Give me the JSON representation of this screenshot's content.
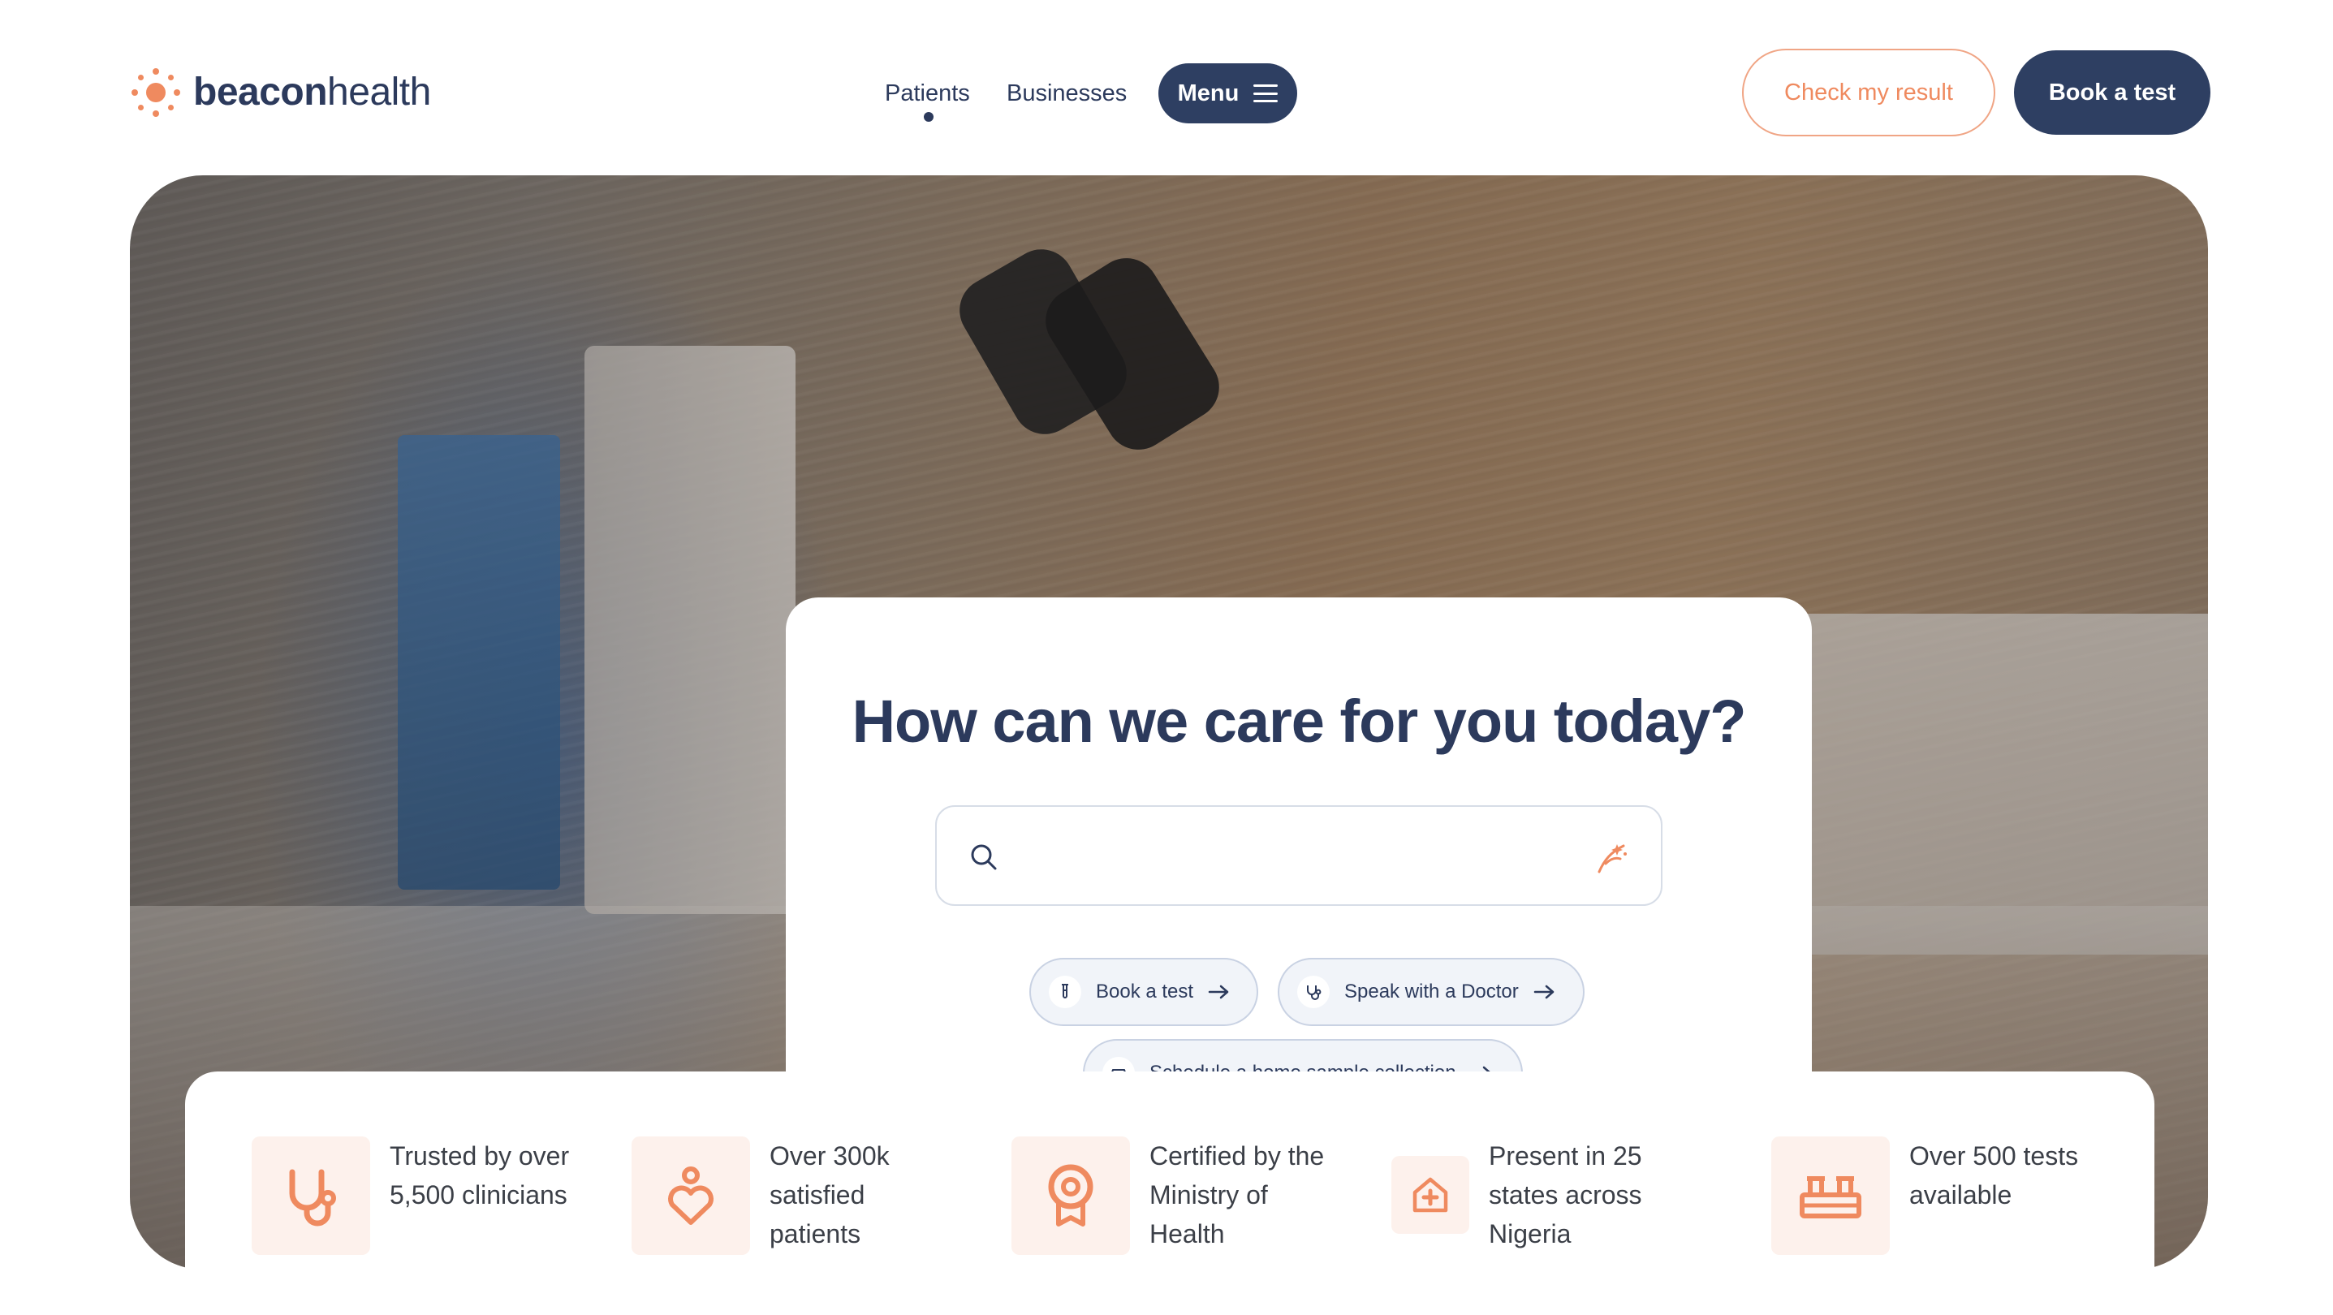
{
  "brand": {
    "name_bold": "beacon",
    "name_light": "health",
    "logo_icon": "sun-dots-icon",
    "accent_color": "#ef8a5f",
    "primary_color": "#2e3f62"
  },
  "nav": {
    "patients_label": "Patients",
    "businesses_label": "Businesses",
    "menu_label": "Menu",
    "active": "Patients"
  },
  "header_actions": {
    "check_result_label": "Check my result",
    "book_test_label": "Book a test"
  },
  "hero": {
    "title": "How can we care for you today?",
    "search": {
      "placeholder": "",
      "value": "",
      "search_icon": "search-icon",
      "assist_icon": "sparkle-icon"
    },
    "quick_actions": [
      {
        "label": "Book a test",
        "icon": "test-tube-icon"
      },
      {
        "label": "Speak with a Doctor",
        "icon": "stethoscope-icon"
      },
      {
        "label": "Schedule a home sample collection",
        "icon": "car-icon"
      }
    ]
  },
  "stats": [
    {
      "icon": "stethoscope-icon",
      "line1": "Trusted by over",
      "line2": "5,500 clinicians",
      "line3": ""
    },
    {
      "icon": "heart-person-icon",
      "line1": "Over 300k",
      "line2": "satisfied",
      "line3": "patients"
    },
    {
      "icon": "award-badge-icon",
      "line1": "Certified by the",
      "line2": "Ministry of",
      "line3": "Health"
    },
    {
      "icon": "hospital-icon",
      "line1": "Present in 25",
      "line2": "states across",
      "line3": "Nigeria"
    },
    {
      "icon": "test-rack-icon",
      "line1": "Over 500 tests",
      "line2": "available",
      "line3": ""
    }
  ]
}
